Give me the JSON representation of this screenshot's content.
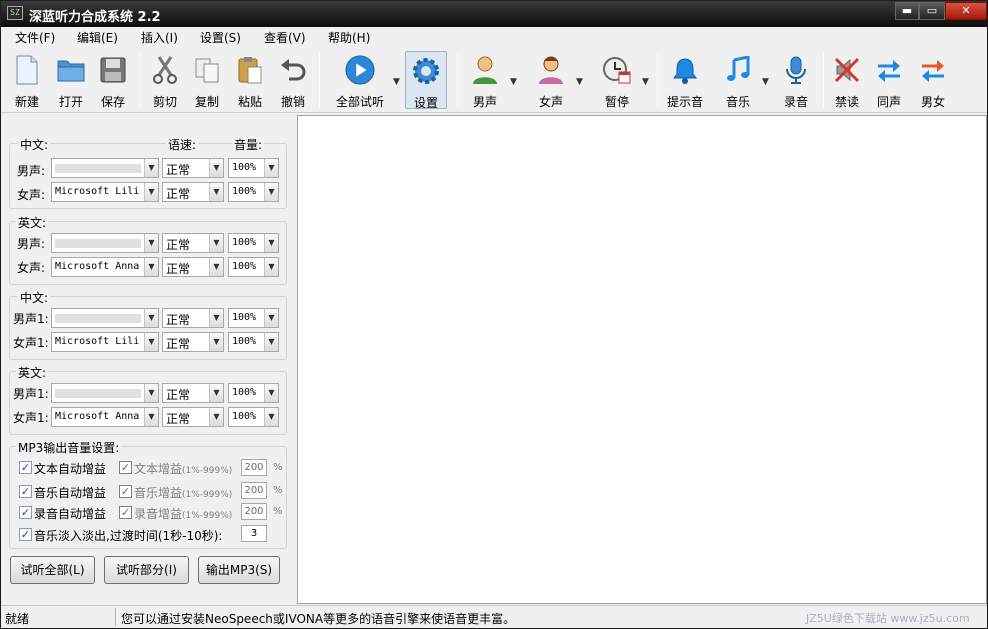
{
  "window": {
    "title": "深蓝听力合成系统 2.2",
    "icon_text": "SZ",
    "min_glyph": "▬",
    "max_glyph": "▭",
    "close_glyph": "✕"
  },
  "menu": [
    {
      "label": "文件(F)"
    },
    {
      "label": "编辑(E)"
    },
    {
      "label": "插入(I)"
    },
    {
      "label": "设置(S)"
    },
    {
      "label": "查看(V)"
    },
    {
      "label": "帮助(H)"
    }
  ],
  "toolbar": {
    "new": "新建",
    "open": "打开",
    "save": "保存",
    "cut": "剪切",
    "copy": "复制",
    "paste": "粘贴",
    "undo": "撤销",
    "play_all": "全部试听",
    "settings": "设置",
    "male": "男声",
    "female": "女声",
    "pause": "暂停",
    "prompt": "提示音",
    "music": "音乐",
    "record": "录音",
    "mute": "禁读",
    "same_voice": "同声",
    "male_female": "男女",
    "dropdown_glyph": "▼"
  },
  "voice_panel": {
    "speed_header": "语速:",
    "volume_header": "音量:",
    "dd": "▼",
    "groups": [
      {
        "title": "中文:",
        "rows": [
          {
            "label": "男声:",
            "engine": "",
            "speed": "正常",
            "volume": "100%"
          },
          {
            "label": "女声:",
            "engine": "Microsoft Lili",
            "speed": "正常",
            "volume": "100%"
          }
        ]
      },
      {
        "title": "英文:",
        "rows": [
          {
            "label": "男声:",
            "engine": "",
            "speed": "正常",
            "volume": "100%"
          },
          {
            "label": "女声:",
            "engine": "Microsoft Anna",
            "speed": "正常",
            "volume": "100%"
          }
        ]
      },
      {
        "title": "中文:",
        "rows": [
          {
            "label": "男声1:",
            "engine": "",
            "speed": "正常",
            "volume": "100%"
          },
          {
            "label": "女声1:",
            "engine": "Microsoft Lili",
            "speed": "正常",
            "volume": "100%"
          }
        ]
      },
      {
        "title": "英文:",
        "rows": [
          {
            "label": "男声1:",
            "engine": "",
            "speed": "正常",
            "volume": "100%"
          },
          {
            "label": "女声1:",
            "engine": "Microsoft Anna",
            "speed": "正常",
            "volume": "100%"
          }
        ]
      }
    ]
  },
  "mp3": {
    "title": "MP3输出音量设置:",
    "check_glyph": "✓",
    "text_auto": "文本自动增益",
    "music_auto": "音乐自动增益",
    "rec_auto": "录音自动增益",
    "text_gain": "文本增益",
    "music_gain": "音乐增益",
    "rec_gain": "录音增益",
    "range": "(1%-999%)",
    "text_gain_value": "200",
    "music_gain_value": "200",
    "rec_gain_value": "200",
    "percent": "%",
    "fade": "音乐淡入淡出,过渡时间(1秒-10秒):",
    "fade_value": "3"
  },
  "buttons": {
    "play_all": "试听全部(L)",
    "play_part": "试听部分(I)",
    "export": "输出MP3(S)"
  },
  "status": {
    "state": "就绪",
    "message": "您可以通过安装NeoSpeech或IVONA等更多的语音引擎来使语音更丰富。",
    "watermark": "JZ5U绿色下载站 www.jz5u.com"
  },
  "colors": {
    "titlebar": "#0d0d0d",
    "close": "#c42b1c",
    "accent": "#22429a"
  }
}
